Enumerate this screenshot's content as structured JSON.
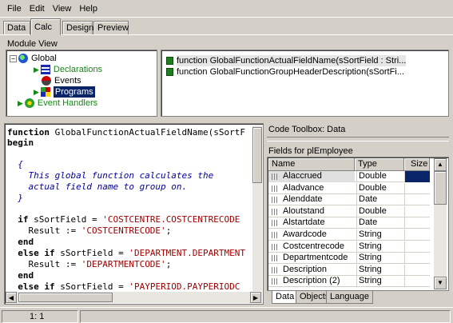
{
  "menu": [
    "File",
    "Edit",
    "View",
    "Help"
  ],
  "tabs": [
    "Data",
    "Calc",
    "Design",
    "Preview"
  ],
  "module_view": {
    "title": "Module View",
    "tree": {
      "global": "Global",
      "declarations": "Declarations",
      "events": "Events",
      "programs": "Programs",
      "event_handlers": "Event Handlers"
    }
  },
  "function_list": [
    "function GlobalFunctionActualFieldName(sSortField : Stri...",
    "function GlobalFunctionGroupHeaderDescription(sSortFi..."
  ],
  "code": {
    "l1a": "function",
    "l1b": " GlobalFunctionActualFieldName(sSortF",
    "l2": "begin",
    "l3": "  {",
    "l4": "    This global function calculates the",
    "l5": "    actual field name to group on.",
    "l6": "  }",
    "l7a": "  if",
    "l7b": " sSortField = ",
    "l7c": "'COSTCENTRE.COSTCENTRECODE",
    "l8a": "    Result := ",
    "l8b": "'COSTCENTRECODE'",
    "l8c": ";",
    "l9": "  end",
    "l10a": "  else if",
    "l10b": " sSortField = ",
    "l10c": "'DEPARTMENT.DEPARTMENT",
    "l11a": "    Result := ",
    "l11b": "'DEPARTMENTCODE'",
    "l11c": ";",
    "l12": "  end",
    "l13a": "  else if",
    "l13b": " sSortField = ",
    "l13c": "'PAYPERIOD.PAYPERIODC"
  },
  "toolbox": {
    "title": "Code Toolbox: Data",
    "fields_title": "Fields for plEmployee",
    "columns": [
      "Name",
      "Type",
      "Size"
    ],
    "rows": [
      {
        "name": "Alaccrued",
        "type": "Double"
      },
      {
        "name": "Aladvance",
        "type": "Double"
      },
      {
        "name": "Alenddate",
        "type": "Date"
      },
      {
        "name": "Aloutstand",
        "type": "Double"
      },
      {
        "name": "Alstartdate",
        "type": "Date"
      },
      {
        "name": "Awardcode",
        "type": "String"
      },
      {
        "name": "Costcentrecode",
        "type": "String"
      },
      {
        "name": "Departmentcode",
        "type": "String"
      },
      {
        "name": "Description",
        "type": "String"
      },
      {
        "name": "Description (2)",
        "type": "String"
      }
    ],
    "bottom_tabs": [
      "Data",
      "Objects",
      "Language"
    ]
  },
  "status": {
    "position": "1: 1"
  }
}
